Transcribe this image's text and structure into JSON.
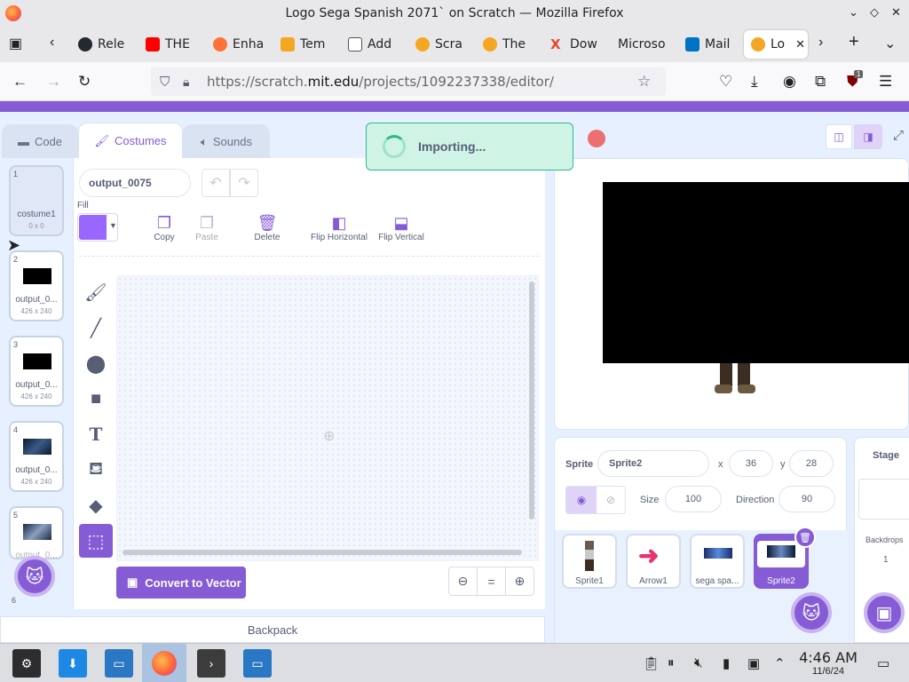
{
  "window": {
    "title": "Logo Sega Spanish 2071` on Scratch — Mozilla Firefox"
  },
  "tabs": [
    {
      "label": "Rele",
      "color": "#24292f"
    },
    {
      "label": "THE",
      "color": "#ff0000"
    },
    {
      "label": "Enha",
      "color": "#ff7139"
    },
    {
      "label": "Tem",
      "color": "#f5a623"
    },
    {
      "label": "Add",
      "color": "#555555"
    },
    {
      "label": "Scra",
      "color": "#f5a623"
    },
    {
      "label": "The",
      "color": "#f5a623"
    },
    {
      "label": "Dow",
      "color": "#e8452c"
    },
    {
      "label": "Microso",
      "color": "#ffffff"
    },
    {
      "label": "Mail",
      "color": "#0072c6"
    },
    {
      "label": "Lo",
      "color": "#f5a623"
    }
  ],
  "address": {
    "prefix": "https://scratch.",
    "domain": "mit.edu",
    "path": "/projects/1092237338/editor/"
  },
  "editor_tabs": {
    "code": "Code",
    "costumes": "Costumes",
    "sounds": "Sounds"
  },
  "costumes": [
    {
      "num": "1",
      "name": "costume1",
      "size": "0 x 0"
    },
    {
      "num": "2",
      "name": "output_0...",
      "size": "426 x 240"
    },
    {
      "num": "3",
      "name": "output_0...",
      "size": "426 x 240"
    },
    {
      "num": "4",
      "name": "output_0...",
      "size": "426 x 240"
    },
    {
      "num": "5",
      "name": "output_0...",
      "size": ""
    },
    {
      "num": "6",
      "name": "",
      "size": ""
    }
  ],
  "paint": {
    "costume_name": "output_0075",
    "fill_label": "Fill",
    "fill_color": "#9966ff",
    "copy": "Copy",
    "paste": "Paste",
    "delete": "Delete",
    "flip_h": "Flip Horizontal",
    "flip_v": "Flip Vertical",
    "convert": "Convert to Vector",
    "zoom_reset": "="
  },
  "toast": {
    "text": "Importing..."
  },
  "sprite_info": {
    "sprite_label": "Sprite",
    "sprite_name": "Sprite2",
    "x_label": "x",
    "x": "36",
    "y_label": "y",
    "y": "28",
    "size_label": "Size",
    "size": "100",
    "direction_label": "Direction",
    "direction": "90"
  },
  "sprites": [
    {
      "name": "Sprite1"
    },
    {
      "name": "Arrow1"
    },
    {
      "name": "sega spa..."
    },
    {
      "name": "Sprite2"
    }
  ],
  "stage": {
    "title": "Stage",
    "backdrops_label": "Backdrops",
    "backdrops_count": "1"
  },
  "backpack": "Backpack",
  "taskbar": {
    "time": "4:46 AM",
    "date": "11/6/24"
  },
  "ublock_count": "1"
}
